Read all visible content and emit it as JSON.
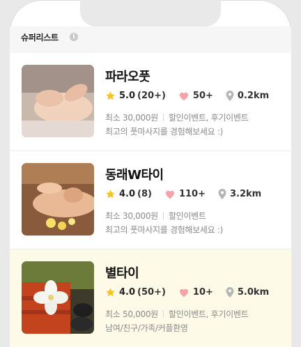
{
  "header": {
    "title": "슈퍼리스트",
    "info_icon": "info-icon"
  },
  "items": [
    {
      "name": "파라오풋",
      "rating": "5.0",
      "review_count": "(20+)",
      "likes": "50+",
      "distance": "0.2km",
      "price": "최소 30,000원",
      "events": "할인이벤트, 후기이벤트",
      "description": "최고의 풋마사지를 경험해보세요 :)",
      "highlight": false
    },
    {
      "name": "동래W타이",
      "rating": "4.0",
      "review_count": "(8)",
      "likes": "110+",
      "distance": "3.2km",
      "price": "최소 30,000원",
      "events": "할인이벤트",
      "description": "최고의 풋마사지를 경험해보세요 :)",
      "highlight": false
    },
    {
      "name": "별타이",
      "rating": "4.0",
      "review_count": "(50+)",
      "likes": "10+",
      "distance": "5.0km",
      "price": "최소 50,000원",
      "events": "할인이벤트, 후기이벤트",
      "description": "남여/친구/가족/커플환영",
      "highlight": true
    }
  ],
  "colors": {
    "star": "#f5c518",
    "heart": "#f7a1a8",
    "pin": "#b5b5b5",
    "highlight_bg": "#fdfbe8"
  }
}
